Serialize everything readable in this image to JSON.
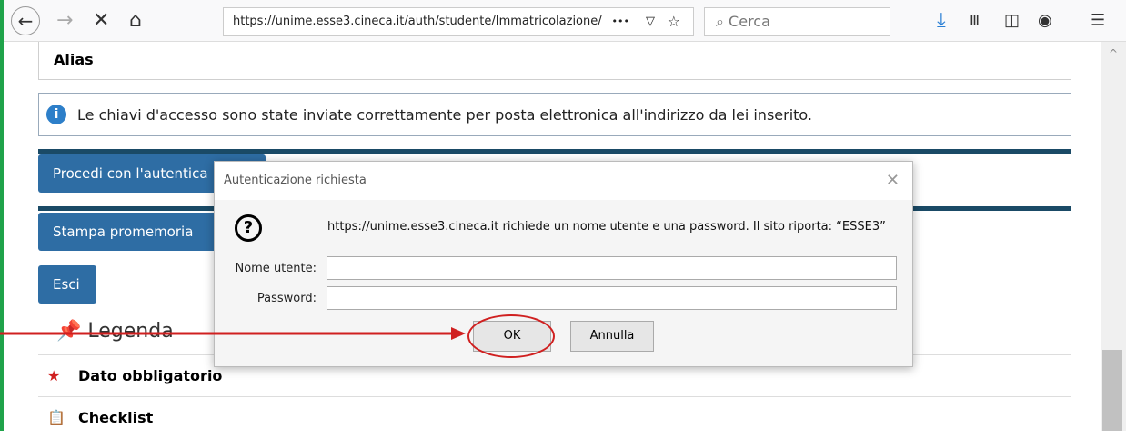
{
  "browser": {
    "url": "https://unime.esse3.cineca.it/auth/studente/Immatricolazione/",
    "search_placeholder": "Cerca",
    "url_more": "•••"
  },
  "page": {
    "alias_label": "Alias",
    "info_text": "Le chiavi d'accesso sono state inviate correttamente per posta elettronica all'indirizzo da lei inserito.",
    "btn_procedi": "Procedi con l'autentica",
    "btn_stampa": "Stampa promemoria",
    "btn_esci": "Esci",
    "legend_title": "Legenda",
    "legend_items": [
      "Dato obbligatorio",
      "Checklist"
    ]
  },
  "dialog": {
    "title": "Autenticazione richiesta",
    "message": "https://unime.esse3.cineca.it richiede un nome utente e una password. Il sito riporta: “ESSE3”",
    "username_label": "Nome utente:",
    "password_label": "Password:",
    "ok_label": "OK",
    "cancel_label": "Annulla"
  },
  "colors": {
    "annotation": "#d02020",
    "primary_button": "#2e6da4"
  }
}
